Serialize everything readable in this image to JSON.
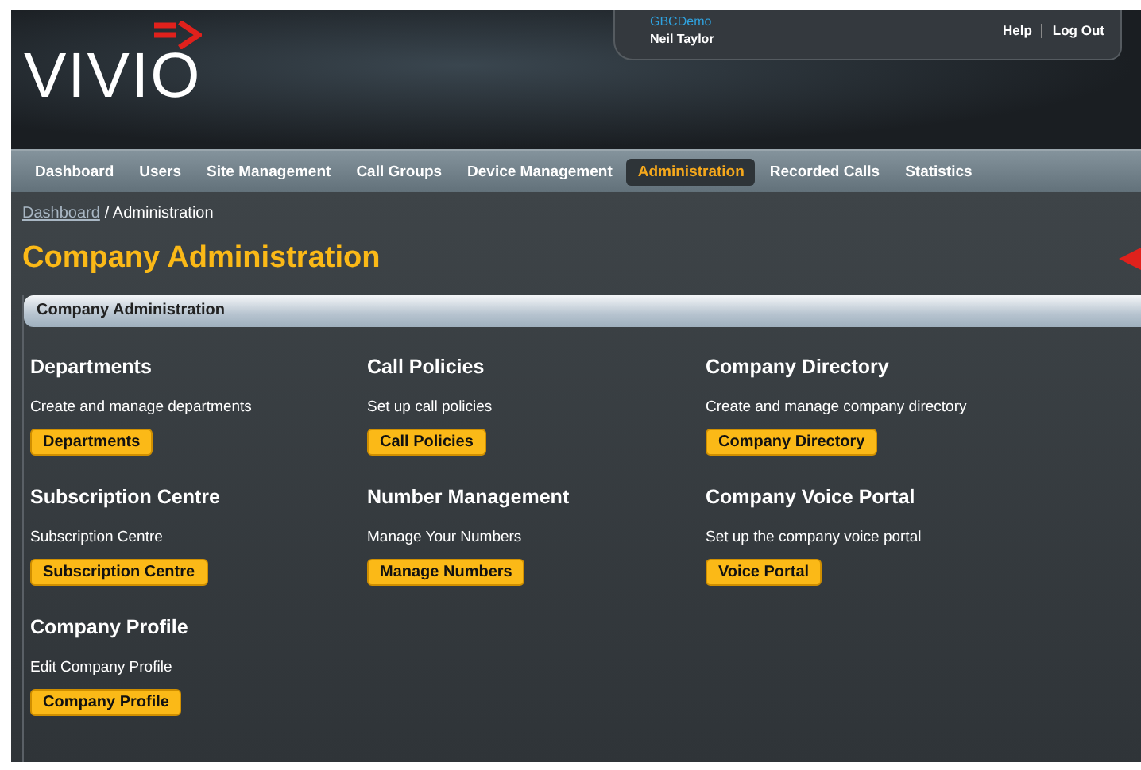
{
  "logo": {
    "text": "VIVIO"
  },
  "user_panel": {
    "company": "GBCDemo",
    "user": "Neil Taylor",
    "links": [
      "Help",
      "Log Out"
    ]
  },
  "nav": [
    {
      "label": "Dashboard",
      "selected": false
    },
    {
      "label": "Users",
      "selected": false
    },
    {
      "label": "Site Management",
      "selected": false
    },
    {
      "label": "Call Groups",
      "selected": false
    },
    {
      "label": "Device Management",
      "selected": false
    },
    {
      "label": "Administration",
      "selected": true
    },
    {
      "label": "Recorded Calls",
      "selected": false
    },
    {
      "label": "Statistics",
      "selected": false
    }
  ],
  "breadcrumb": {
    "link": "Dashboard",
    "separator": "/",
    "current": "Administration"
  },
  "page_title": "Company Administration",
  "panel": {
    "title": "Company Administration",
    "sections": [
      {
        "heading": "Departments",
        "description": "Create and manage departments",
        "button": "Departments"
      },
      {
        "heading": "Call Policies",
        "description": "Set up call policies",
        "button": "Call Policies"
      },
      {
        "heading": "Company Directory",
        "description": "Create and manage company directory",
        "button": "Company Directory"
      },
      {
        "heading": "Subscription Centre",
        "description": "Subscription Centre",
        "button": "Subscription Centre"
      },
      {
        "heading": "Number Management",
        "description": "Manage Your Numbers",
        "button": "Manage Numbers"
      },
      {
        "heading": "Company Voice Portal",
        "description": "Set up the company voice portal",
        "button": "Voice Portal"
      },
      {
        "heading": "Company Profile",
        "description": "Edit Company Profile",
        "button": "Company Profile"
      }
    ]
  }
}
